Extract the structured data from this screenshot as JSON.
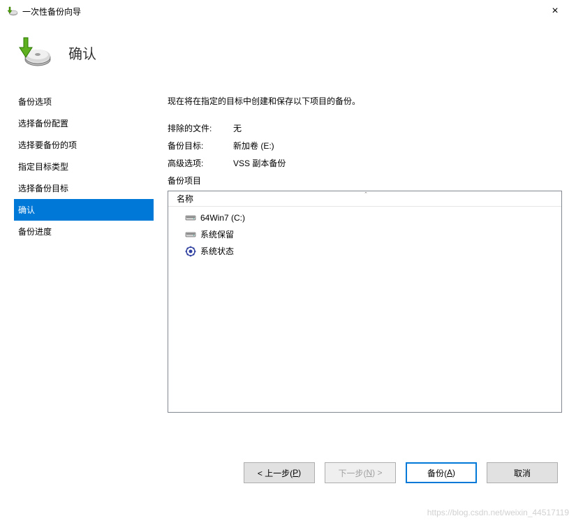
{
  "window": {
    "title": "一次性备份向导",
    "close": "×"
  },
  "header": {
    "title": "确认"
  },
  "sidebar": {
    "items": [
      {
        "label": "备份选项",
        "selected": false
      },
      {
        "label": "选择备份配置",
        "selected": false
      },
      {
        "label": "选择要备份的项",
        "selected": false
      },
      {
        "label": "指定目标类型",
        "selected": false
      },
      {
        "label": "选择备份目标",
        "selected": false
      },
      {
        "label": "确认",
        "selected": true
      },
      {
        "label": "备份进度",
        "selected": false
      }
    ]
  },
  "main": {
    "intro": "现在将在指定的目标中创建和保存以下项目的备份。",
    "rows": [
      {
        "label": "排除的文件:",
        "value": "无"
      },
      {
        "label": "备份目标:",
        "value": "新加卷 (E:)"
      },
      {
        "label": "高级选项:",
        "value": "VSS 副本备份"
      }
    ],
    "list_label": "备份项目",
    "list_header": "名称",
    "sort_indicator": "ˆ",
    "list_items": [
      {
        "icon": "drive",
        "label": "64Win7  (C:)"
      },
      {
        "icon": "drive",
        "label": "系统保留"
      },
      {
        "icon": "gear",
        "label": "系统状态"
      }
    ]
  },
  "footer": {
    "prev_prefix": "< 上一步(",
    "prev_key": "P",
    "prev_suffix": ")",
    "next_prefix": "下一步(",
    "next_key": "N",
    "next_suffix": ") >",
    "backup_prefix": "备份(",
    "backup_key": "A",
    "backup_suffix": ")",
    "cancel": "取消"
  },
  "watermark": "https://blog.csdn.net/weixin_44517119"
}
